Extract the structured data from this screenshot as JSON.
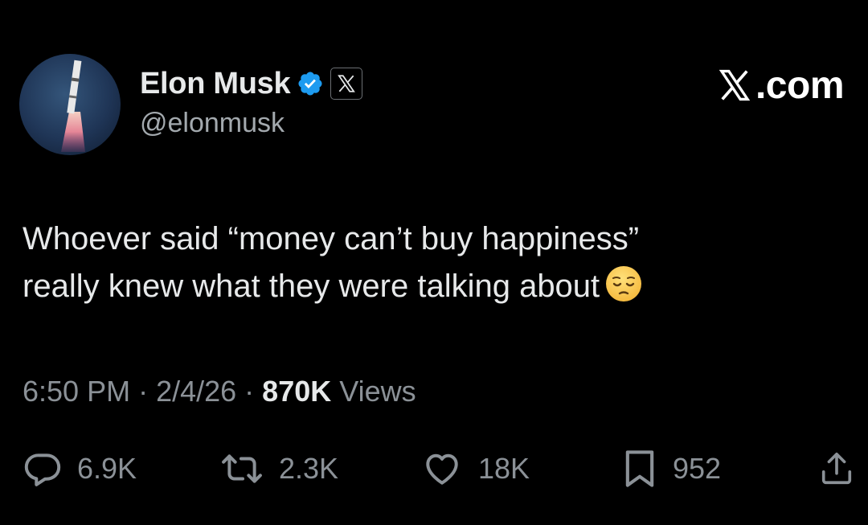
{
  "author": {
    "display_name": "Elon Musk",
    "handle": "@elonmusk",
    "avatar": "rocket-launch-avatar",
    "verified_badge": "verified-checkmark-icon",
    "affiliation_badge": "x-logo-icon"
  },
  "brand": {
    "label": ".com",
    "icon": "x-logo-icon"
  },
  "tweet": {
    "line1": "Whoever said “money can’t buy happiness”",
    "line2": "really knew what they were talking about",
    "emoji": "pensive-face-emoji"
  },
  "meta": {
    "time": "6:50 PM",
    "separator": " · ",
    "date": "2/4/26",
    "views_count": "870K",
    "views_label": " Views"
  },
  "actions": {
    "replies": "6.9K",
    "reposts": "2.3K",
    "likes": "18K",
    "bookmarks": "952"
  },
  "colors": {
    "background": "#000000",
    "text": "#e7e9ea",
    "muted": "#8b9197",
    "verified_blue": "#1d9bf0"
  }
}
